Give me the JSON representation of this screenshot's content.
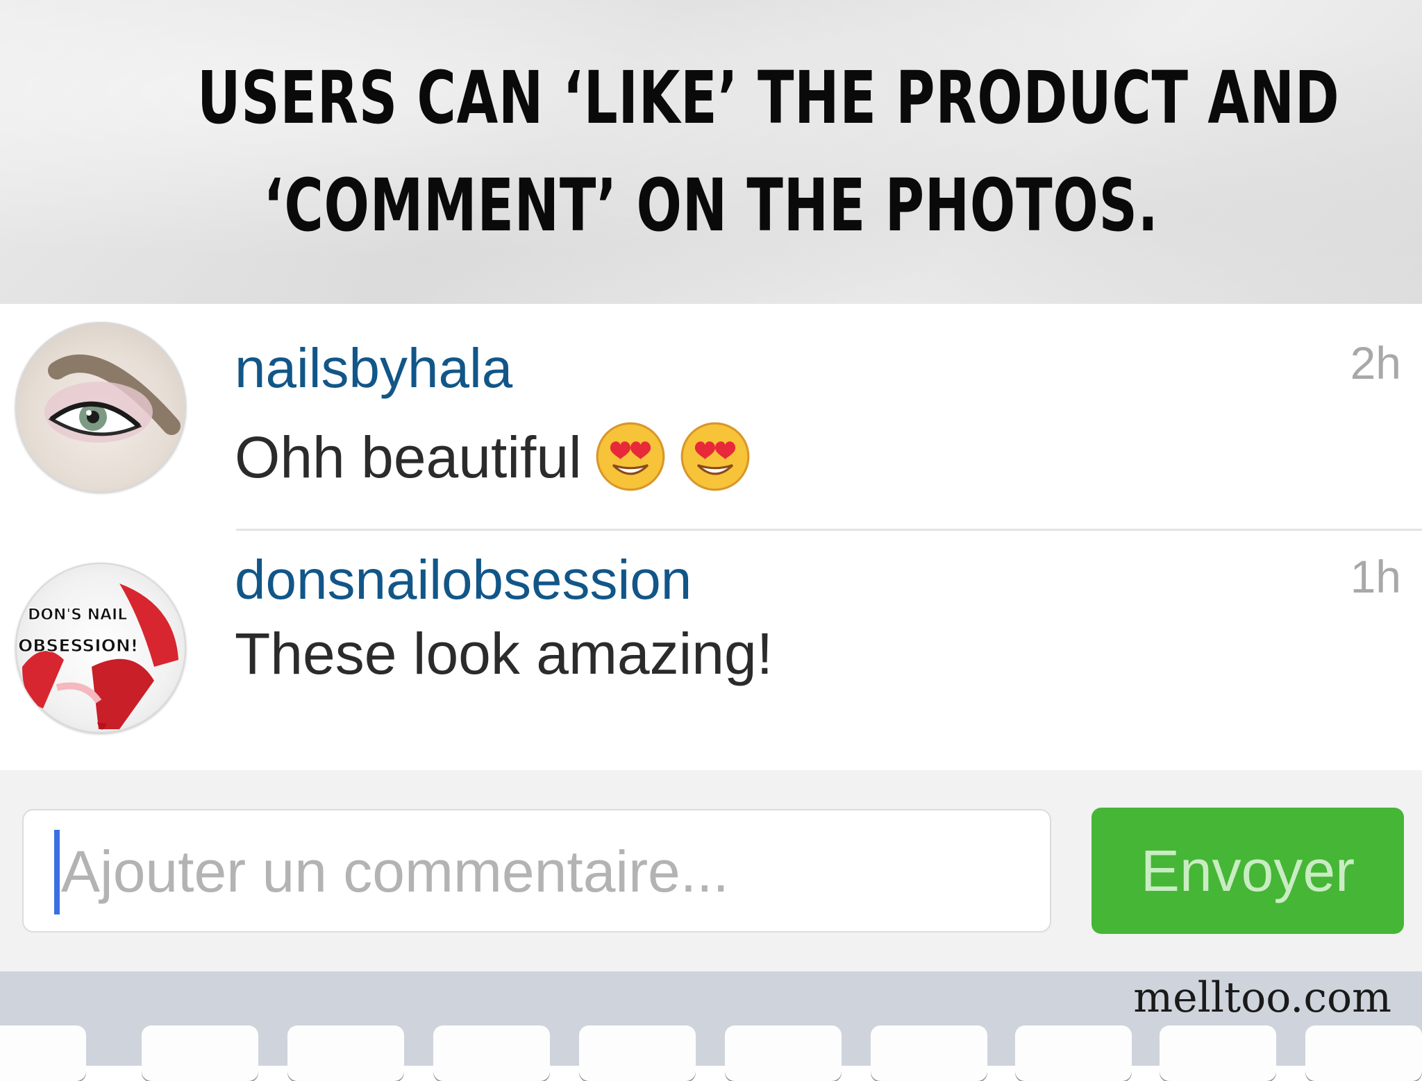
{
  "headline": {
    "line1": "USERS CAN ‘LIKE’ THE PRODUCT AND",
    "line2": "‘COMMENT’ ON THE PHOTOS."
  },
  "comments": [
    {
      "username": "nailsbyhala",
      "text": "Ohh beautiful",
      "emojis": [
        "heart-eyes-emoji",
        "heart-eyes-emoji"
      ],
      "time": "2h",
      "avatar": "eye-makeup-avatar"
    },
    {
      "username": "donsnailobsession",
      "text": "These look amazing!",
      "time": "1h",
      "avatar": "nail-obsession-avatar",
      "avatar_lettering": [
        "DON'S NAIL",
        "OBSESSION!"
      ]
    }
  ],
  "composer": {
    "placeholder": "Ajouter un commentaire...",
    "send_label": "Envoyer"
  },
  "watermark": "melltoo.com",
  "colors": {
    "username": "#125688",
    "send_button": "#45b635",
    "send_text": "#c9ecc2",
    "caret": "#3a6fe0",
    "timestamp": "#a8a8a8"
  }
}
